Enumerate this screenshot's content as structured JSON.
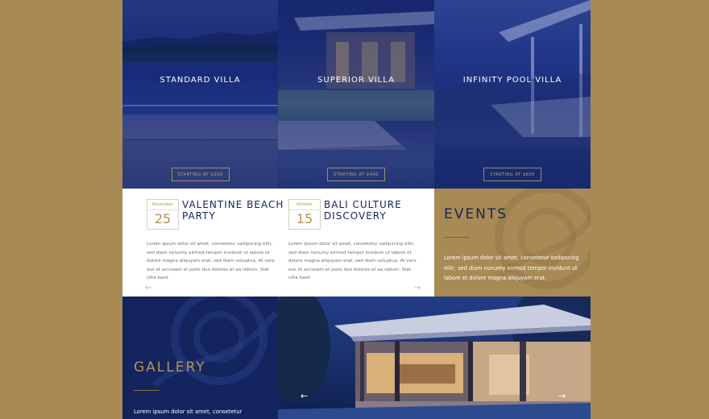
{
  "villas": [
    {
      "title": "STANDARD VILLA",
      "price": "STARTING AT $200"
    },
    {
      "title": "SUPERIOR VILLA",
      "price": "STARTING AT $400"
    },
    {
      "title": "INFINITY POOL VILLA",
      "price": "STARTING AT $600"
    }
  ],
  "events_list": [
    {
      "month": "November",
      "day": "25",
      "title": "VALENTINE BEACH PARTY",
      "body": "Lorem ipsum dolor sit amet, consetetur sadipscing elitr, sed diam nonumy eirmod tempor invidunt ut labore et dolore magna aliquyam erat, sed diam voluptua. At vero eos et accusam et justo duo dolores et ea rebum. Stet clita kasd"
    },
    {
      "month": "October",
      "day": "15",
      "title": "BALI CULTURE DISCOVERY",
      "body": "Lorem ipsum dolor sit amet, consetetur sadipscing elitr, sed diam nonumy eirmod tempor invidunt ut labore et dolore magna aliquyam erat, sed diam voluptua. At vero eos et accusam et justo duo dolores et ea rebum. Stet clita kasd"
    }
  ],
  "events_nav": {
    "prev": "←",
    "next": "→"
  },
  "events_panel": {
    "heading": "EVENTS",
    "body": "Lorem ipsum dolor sit amet, consetetur sadipscing elitr, sed diam nonumy eirmod tempor invidunt ut labore et dolore magna aliquyam erat."
  },
  "gallery": {
    "heading": "GALLERY",
    "body": "Lorem ipsum dolor sit amet, consetetur",
    "prev": "←",
    "next": "→"
  },
  "colors": {
    "navy": "#13245f",
    "gold": "#a88a55",
    "white": "#ffffff"
  }
}
